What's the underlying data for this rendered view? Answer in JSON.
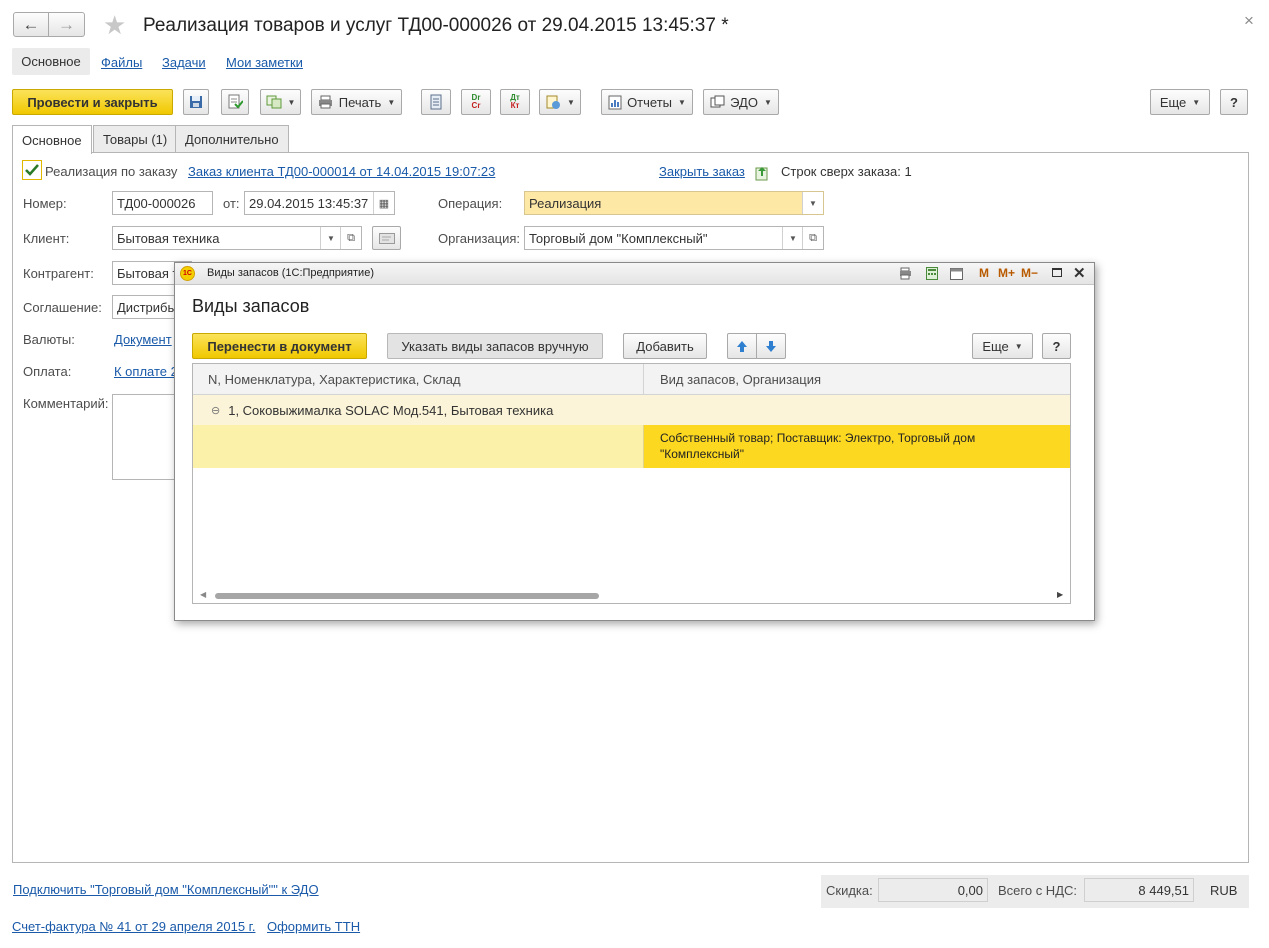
{
  "window": {
    "title": "Реализация товаров и услуг ТД00-000026 от 29.04.2015 13:45:37 *",
    "nav_back": "←",
    "nav_forward": "→",
    "favorite_icon": "star-icon",
    "close_glyph": "×"
  },
  "top_tabs": [
    {
      "label": "Основное"
    },
    {
      "label": "Файлы"
    },
    {
      "label": "Задачи"
    },
    {
      "label": "Мои заметки"
    }
  ],
  "toolbar": {
    "post_and_close": "Провести и закрыть",
    "print": "Печать",
    "reports": "Отчеты",
    "edo": "ЭДО",
    "more": "Еще",
    "help": "?",
    "dt_kt_1": "Dr Cr",
    "dt_kt_2": "Дт Кт"
  },
  "form_tabs": [
    {
      "label": "Основное"
    },
    {
      "label": "Товары (1)"
    },
    {
      "label": "Дополнительно"
    }
  ],
  "form": {
    "by_order_label": "Реализация по заказу",
    "by_order_checked": true,
    "order_link": "Заказ клиента ТД00-000014 от 14.04.2015 19:07:23",
    "close_order_link": "Закрыть заказ",
    "rows_over_order": "Строк сверх заказа: 1",
    "number_label": "Номер:",
    "number_value": "ТД00-000026",
    "date_label": "от:",
    "date_value": "29.04.2015 13:45:37",
    "operation_label": "Операция:",
    "operation_value": "Реализация",
    "client_label": "Клиент:",
    "client_value": "Бытовая техника",
    "org_label": "Организация:",
    "org_value": "Торговый дом \"Комплексный\"",
    "contractor_label": "Контрагент:",
    "contractor_value": "Бытовая т",
    "agreement_label": "Соглашение:",
    "agreement_value": "Дистрибь",
    "currency_label": "Валюты:",
    "currency_value": "Документ",
    "payment_label": "Оплата:",
    "payment_value": "К оплате 2",
    "comment_label": "Комментарий:"
  },
  "footer": {
    "edo_link": "Подключить \"Торговый дом \"Комплексный\"\" к ЭДО",
    "invoice_link": "Счет-фактура № 41 от 29 апреля 2015 г.",
    "ttn_link": "Оформить ТТН",
    "discount_label": "Скидка:",
    "discount_value": "0,00",
    "total_label": "Всего с НДС:",
    "total_value": "8 449,51",
    "currency": "RUB"
  },
  "dialog": {
    "window_title": "Виды запасов  (1С:Предприятие)",
    "heading": "Виды запасов",
    "app_icon": "1c-logo-icon",
    "title_buttons": [
      "M",
      "M+",
      "M−"
    ],
    "transfer_button": "Перенести в документ",
    "manual_button": "Указать виды запасов вручную",
    "add_button": "Добавить",
    "more_button": "Еще",
    "help_button": "?",
    "columns": [
      "N, Номенклатура, Характеристика, Склад",
      "Вид запасов, Организация"
    ],
    "group_row": "1, Соковыжималка  SOLAC  Мод.541, Бытовая техника",
    "detail_line1": "Собственный товар; Поставщик: Электро, Торговый дом",
    "detail_line2": "\"Комплексный\"",
    "scroll_fraction": 0.46
  },
  "colors": {
    "accent_yellow": "#f5d000",
    "link": "#1a5aa9",
    "selected_row": "#fcd820",
    "group_row": "#fbf4d8",
    "operation_field": "#fde8a6"
  }
}
